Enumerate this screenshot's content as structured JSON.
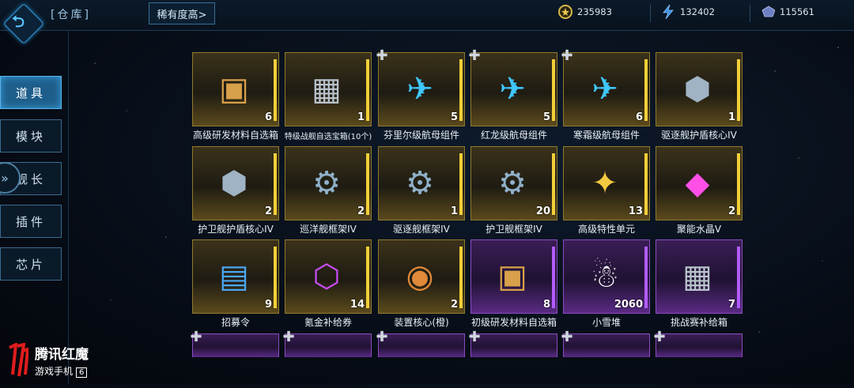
{
  "header": {
    "title": "[仓库]",
    "sort_label": "稀有度高>",
    "resources": [
      {
        "icon": "gold-coin-icon",
        "value": "235983",
        "color": "#d8b84a"
      },
      {
        "icon": "energy-bolt-icon",
        "value": "132402",
        "color": "#3b8fe0"
      },
      {
        "icon": "crystal-ore-icon",
        "value": "115561",
        "color": "#7b8fd4"
      }
    ]
  },
  "sidebar": {
    "tabs": [
      {
        "label": "道具",
        "active": true
      },
      {
        "label": "模块",
        "active": false
      },
      {
        "label": "舰长",
        "active": false
      },
      {
        "label": "插件",
        "active": false
      },
      {
        "label": "芯片",
        "active": false
      }
    ]
  },
  "items": [
    {
      "name": "高级研发材料自选箱",
      "count": "6",
      "rarity": "gold",
      "icon": "treasure-chest-icon",
      "puzzle": false
    },
    {
      "name": "特级战舰自选宝箱(10个)",
      "count": "1",
      "rarity": "gold",
      "icon": "supply-crate-icon",
      "puzzle": false
    },
    {
      "name": "芬里尔级航母组件",
      "count": "5",
      "rarity": "gold",
      "icon": "carrier-blueprint-icon",
      "puzzle": true
    },
    {
      "name": "红龙级航母组件",
      "count": "5",
      "rarity": "gold",
      "icon": "carrier-blueprint-icon",
      "puzzle": true
    },
    {
      "name": "寒霜级航母组件",
      "count": "6",
      "rarity": "gold",
      "icon": "carrier-blueprint-icon",
      "puzzle": true
    },
    {
      "name": "驱逐舰护盾核心IV",
      "count": "1",
      "rarity": "gold",
      "icon": "shield-core-icon",
      "puzzle": false
    },
    {
      "name": "护卫舰护盾核心IV",
      "count": "2",
      "rarity": "gold",
      "icon": "shield-core-icon",
      "puzzle": false
    },
    {
      "name": "巡洋舰框架IV",
      "count": "2",
      "rarity": "gold",
      "icon": "ship-frame-icon",
      "puzzle": false
    },
    {
      "name": "驱逐舰框架IV",
      "count": "1",
      "rarity": "gold",
      "icon": "ship-frame-icon",
      "puzzle": false
    },
    {
      "name": "护卫舰框架IV",
      "count": "20",
      "rarity": "gold",
      "icon": "ship-frame-icon",
      "puzzle": false
    },
    {
      "name": "高级特性单元",
      "count": "13",
      "rarity": "gold",
      "icon": "trait-unit-icon",
      "puzzle": false
    },
    {
      "name": "聚能水晶V",
      "count": "2",
      "rarity": "gold",
      "icon": "energy-crystal-icon",
      "puzzle": false
    },
    {
      "name": "招募令",
      "count": "9",
      "rarity": "gold",
      "icon": "recruit-card-icon",
      "puzzle": false
    },
    {
      "name": "氪金补给券",
      "count": "14",
      "rarity": "gold",
      "icon": "supply-voucher-icon",
      "puzzle": false
    },
    {
      "name": "装置核心(橙)",
      "count": "2",
      "rarity": "gold",
      "icon": "device-core-icon",
      "puzzle": false
    },
    {
      "name": "初级研发材料自选箱",
      "count": "8",
      "rarity": "purple",
      "icon": "treasure-chest-icon",
      "puzzle": false
    },
    {
      "name": "小雪堆",
      "count": "2060",
      "rarity": "purple",
      "icon": "snowman-icon",
      "puzzle": false
    },
    {
      "name": "挑战赛补给箱",
      "count": "7",
      "rarity": "purple",
      "icon": "supply-crate-icon",
      "puzzle": false
    }
  ],
  "partial_row": [
    {
      "rarity": "purple",
      "puzzle": true
    },
    {
      "rarity": "purple",
      "puzzle": true
    },
    {
      "rarity": "purple",
      "puzzle": true
    },
    {
      "rarity": "purple",
      "puzzle": true
    },
    {
      "rarity": "purple",
      "puzzle": true
    },
    {
      "rarity": "purple",
      "puzzle": true
    }
  ],
  "brand": {
    "title": "腾讯红魔",
    "subtitle": "游戏手机",
    "model": "6"
  }
}
